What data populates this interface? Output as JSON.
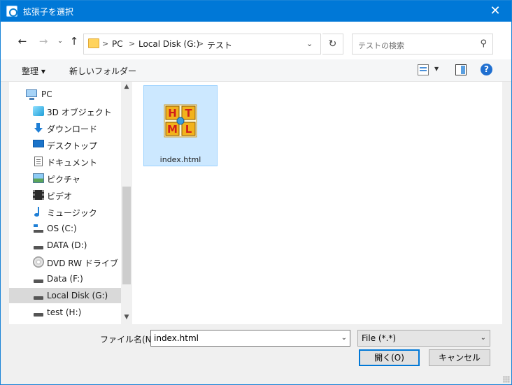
{
  "window": {
    "title": "拡張子を選択",
    "close_glyph": "✕"
  },
  "nav": {
    "back_glyph": "←",
    "forward_glyph": "→",
    "recent_glyph": "⌄",
    "up_glyph": "↑"
  },
  "address": {
    "crumbs": [
      "PC",
      "Local Disk (G:)",
      "テスト"
    ],
    "separator": ">",
    "dropdown_glyph": "⌄",
    "refresh_glyph": "↻"
  },
  "search": {
    "placeholder": "テストの検索",
    "icon_glyph": "⚲"
  },
  "toolbar": {
    "organize_label": "整理 ▾",
    "new_folder_label": "新しいフォルダー",
    "help_glyph": "?"
  },
  "sidebar": {
    "items": [
      {
        "label": "PC",
        "icon": "pc-icon"
      },
      {
        "label": "3D オブジェクト",
        "icon": "3d-objects-icon"
      },
      {
        "label": "ダウンロード",
        "icon": "download-icon"
      },
      {
        "label": "デスクトップ",
        "icon": "desktop-icon"
      },
      {
        "label": "ドキュメント",
        "icon": "document-icon"
      },
      {
        "label": "ピクチャ",
        "icon": "picture-icon"
      },
      {
        "label": "ビデオ",
        "icon": "video-icon"
      },
      {
        "label": "ミュージック",
        "icon": "music-icon"
      },
      {
        "label": "OS (C:)",
        "icon": "os-drive-icon"
      },
      {
        "label": "DATA (D:)",
        "icon": "drive-icon"
      },
      {
        "label": "DVD RW ドライブ (E:)",
        "icon": "dvd-drive-icon"
      },
      {
        "label": "Data (F:)",
        "icon": "drive-icon"
      },
      {
        "label": "Local Disk (G:)",
        "icon": "drive-icon",
        "selected": true
      },
      {
        "label": "test (H:)",
        "icon": "drive-icon"
      }
    ],
    "scroll_up_glyph": "▲",
    "scroll_down_glyph": "▼"
  },
  "files": [
    {
      "name": "index.html",
      "icon": "html-file-icon",
      "selected": true
    }
  ],
  "bottom": {
    "filename_label": "ファイル名(N):",
    "filename_value": "index.html",
    "filetype_value": "File (*.*)",
    "open_label": "開く(O)",
    "cancel_label": "キャンセル",
    "dropdown_glyph": "⌄"
  },
  "colors": {
    "titlebar": "#0078d7",
    "selection": "#cce8ff",
    "sidebar_selected": "#d9d9d9",
    "accent": "#0078d7"
  }
}
